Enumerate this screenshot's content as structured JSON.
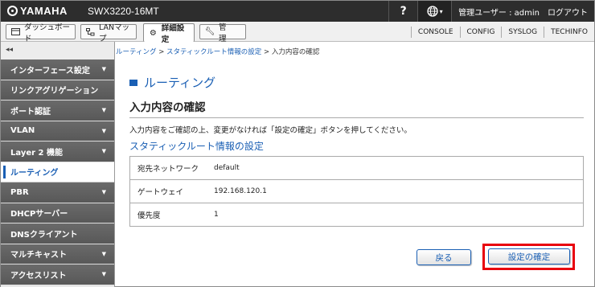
{
  "header": {
    "logo": "YAMAHA",
    "model": "SWX3220-16MT",
    "help": "?",
    "globe_caret": "▾",
    "user_label": "管理ユーザー : admin",
    "logout": "ログアウト"
  },
  "tabs": [
    {
      "label": "ダッシュボード",
      "icon": "dashboard-icon"
    },
    {
      "label": "LANマップ",
      "icon": "lan-map-icon"
    },
    {
      "label": "詳細設定",
      "icon": "gear-icon"
    },
    {
      "label": "管　理",
      "icon": "wrench-icon"
    }
  ],
  "top_links": [
    "CONSOLE",
    "CONFIG",
    "SYSLOG",
    "TECHINFO"
  ],
  "sidebar": {
    "collapse": "◂◂",
    "items": [
      {
        "label": "インターフェース設定",
        "arrow": "▼"
      },
      {
        "label": "リンクアグリゲーション",
        "arrow": ""
      },
      {
        "label": "ポート認証",
        "arrow": "▼"
      },
      {
        "label": "VLAN",
        "arrow": "▼"
      },
      {
        "label": "Layer 2 機能",
        "arrow": "▼"
      },
      {
        "label": "ルーティング",
        "arrow": ""
      },
      {
        "label": "PBR",
        "arrow": "▼"
      },
      {
        "label": "DHCPサーバー",
        "arrow": ""
      },
      {
        "label": "DNSクライアント",
        "arrow": ""
      },
      {
        "label": "マルチキャスト",
        "arrow": "▼"
      },
      {
        "label": "アクセスリスト",
        "arrow": "▼"
      }
    ]
  },
  "breadcrumb": {
    "b1": "ルーティング",
    "sep": " > ",
    "b2": "スタティックルート情報の設定",
    "b3": "入力内容の確認"
  },
  "page": {
    "title": "ルーティング",
    "subtitle": "入力内容の確認",
    "instruction": "入力内容をご確認の上、変更がなければ「設定の確定」ボタンを押してください。",
    "section": "スタティックルート情報の設定"
  },
  "table": [
    {
      "key": "宛先ネットワーク",
      "value": "default"
    },
    {
      "key": "ゲートウェイ",
      "value": "192.168.120.1"
    },
    {
      "key": "優先度",
      "value": "1"
    }
  ],
  "buttons": {
    "back": "戻る",
    "confirm": "設定の確定"
  },
  "colors": {
    "accent": "#1a5fb4",
    "highlight": "#e8000d",
    "topbar": "#2d2d2d",
    "sidebar": "#5f5f5f"
  }
}
